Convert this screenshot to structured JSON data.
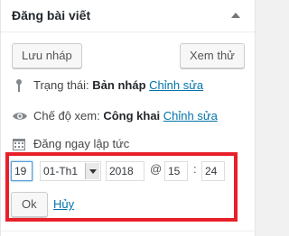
{
  "panel": {
    "title": "Đăng bài viết"
  },
  "actions": {
    "save_draft_label": "Lưu nháp",
    "preview_label": "Xem thử"
  },
  "status": {
    "label": "Trạng thái:",
    "value": "Bản nháp",
    "edit_link": "Chỉnh sửa",
    "icon": "pin-icon"
  },
  "visibility": {
    "label": "Chế độ xem:",
    "value": "Công khai",
    "edit_link": "Chỉnh sửa",
    "icon": "eye-icon"
  },
  "schedule": {
    "label": "Đăng ngay lập tức",
    "icon": "calendar-icon"
  },
  "datetime": {
    "day": "19",
    "month": "01-Th1",
    "year": "2018",
    "at_sep": "@",
    "hour": "15",
    "time_sep": ":",
    "minute": "24",
    "ok_label": "Ok",
    "cancel_label": "Hủy"
  },
  "colors": {
    "highlight": "#e8202a",
    "link": "#0073aa"
  }
}
